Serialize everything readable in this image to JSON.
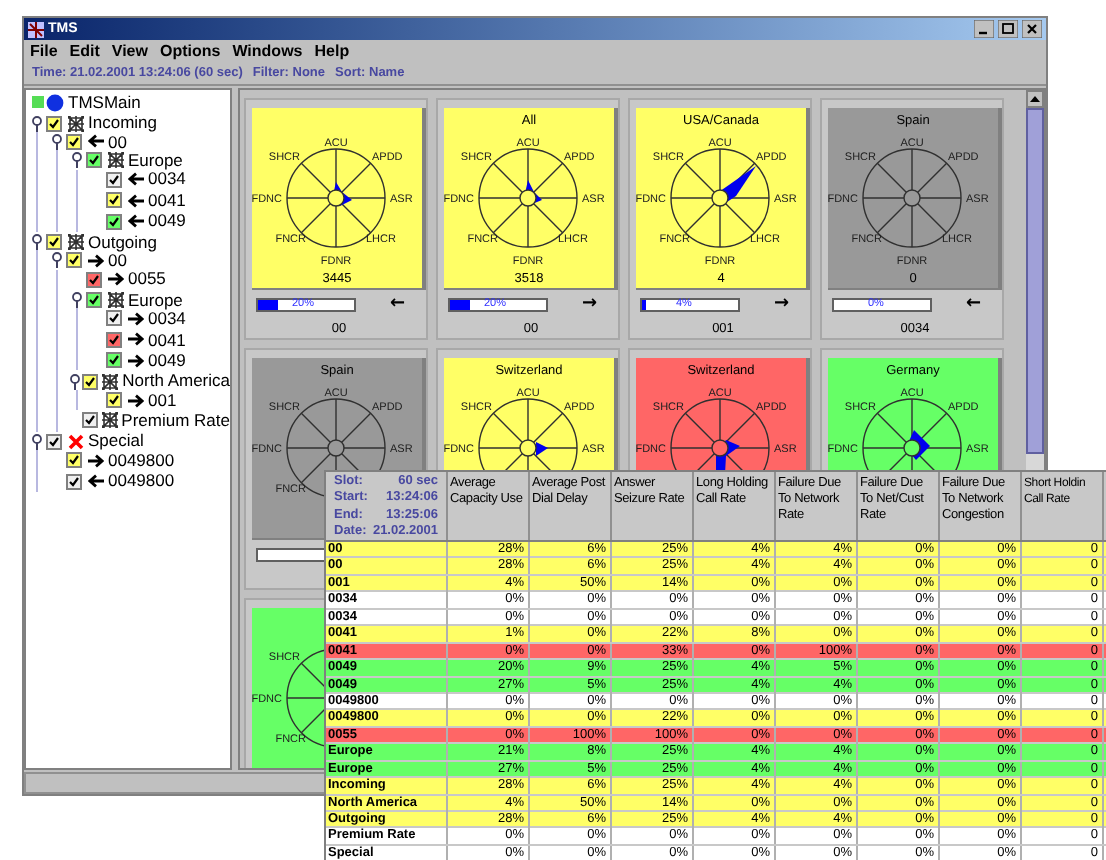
{
  "window": {
    "title": "TMS"
  },
  "menu": [
    "File",
    "Edit",
    "View",
    "Options",
    "Windows",
    "Help"
  ],
  "info": [
    "Time: 21.02.2001 13:24:06 (60 sec)",
    "Filter: None",
    "Sort: Name"
  ],
  "tree": {
    "root": {
      "label": "TMSMain",
      "children": [
        {
          "label": "Incoming",
          "kind": "group",
          "color": "#ffff66",
          "checked": true,
          "expanded": true,
          "children": [
            {
              "label": "00",
              "kind": "in",
              "color": "#ffff66",
              "checked": true,
              "expanded": true,
              "children": [
                {
                  "label": "Europe",
                  "kind": "group",
                  "color": "#66ff66",
                  "checked": true,
                  "expanded": true,
                  "children": [
                    {
                      "label": "0034",
                      "kind": "in",
                      "color": "#f0f0f0",
                      "checked": true
                    },
                    {
                      "label": "0041",
                      "kind": "in",
                      "color": "#ffff66",
                      "checked": true
                    },
                    {
                      "label": "0049",
                      "kind": "in",
                      "color": "#66ff66",
                      "checked": true
                    }
                  ]
                }
              ]
            }
          ]
        },
        {
          "label": "Outgoing",
          "kind": "group",
          "color": "#ffff66",
          "checked": true,
          "expanded": true,
          "children": [
            {
              "label": "00",
              "kind": "out",
              "color": "#ffff66",
              "checked": true,
              "expanded": true,
              "children": [
                {
                  "label": "0055",
                  "kind": "out",
                  "color": "#ff6666",
                  "checked": true
                },
                {
                  "label": "Europe",
                  "kind": "group",
                  "color": "#66ff66",
                  "checked": true,
                  "expanded": true,
                  "children": [
                    {
                      "label": "0034",
                      "kind": "out",
                      "color": "#f0f0f0",
                      "checked": true
                    },
                    {
                      "label": "0041",
                      "kind": "out",
                      "color": "#ff6666",
                      "checked": true
                    },
                    {
                      "label": "0049",
                      "kind": "out",
                      "color": "#66ff66",
                      "checked": true
                    }
                  ]
                },
                {
                  "label": "North America",
                  "kind": "group",
                  "color": "#ffff66",
                  "checked": true,
                  "expanded": true,
                  "children": [
                    {
                      "label": "001",
                      "kind": "out",
                      "color": "#ffff66",
                      "checked": true
                    }
                  ]
                },
                {
                  "label": "Premium Rate",
                  "kind": "group",
                  "color": "#f0f0f0",
                  "checked": true
                }
              ]
            }
          ]
        },
        {
          "label": "Special",
          "kind": "special",
          "color": "#f0f0f0",
          "checked": true,
          "expanded": true,
          "children": [
            {
              "label": "0049800",
              "kind": "out",
              "color": "#ffff66",
              "checked": true
            },
            {
              "label": "0049800",
              "kind": "in",
              "color": "#f0f0f0",
              "checked": true
            }
          ]
        }
      ]
    }
  },
  "cards": [
    {
      "color": "#ffff66",
      "axes": {
        "n": "ACU",
        "ne": "APDD",
        "e": "ASR",
        "se": "LHCR",
        "s": "FDNR",
        "sw": "FNCR",
        "w": "FDNC",
        "nw": "SHCR"
      },
      "count": "3445",
      "level": 0.2,
      "reading": "20%",
      "arrow": "←",
      "code": "00"
    },
    {
      "title": "All",
      "color": "#ffff66",
      "axes": {
        "n": "ACU",
        "ne": "APDD",
        "e": "ASR",
        "se": "LHCR",
        "s": "FDNR",
        "sw": "FNCR",
        "w": "FDNC",
        "nw": "SHCR"
      },
      "count": "3518",
      "level": 0.2,
      "reading": "20%",
      "arrow": "→",
      "code": "00"
    },
    {
      "title": "USA/Canada",
      "color": "#ffff66",
      "axes": {
        "n": "ACU",
        "ne": "APDD",
        "e": "ASR",
        "se": "LHCR",
        "s": "FDNR",
        "sw": "FNCR",
        "w": "FDNC",
        "nw": "SHCR"
      },
      "count": "4",
      "level": 0.04,
      "reading": "4%",
      "arrow": "→",
      "code": "001"
    },
    {
      "title": "Spain",
      "color": "#999999",
      "axes": {
        "n": "ACU",
        "ne": "APDD",
        "e": "ASR",
        "se": "LHCR",
        "s": "FDNR",
        "sw": "FNCR",
        "w": "FDNC",
        "nw": "SHCR"
      },
      "count": "0",
      "level": 0,
      "reading": "0%",
      "arrow": "←",
      "code": "0034"
    },
    {
      "title": "Spain",
      "color": "#999999",
      "axes": {
        "n": "ACU",
        "ne": "APDD",
        "e": "ASR",
        "sw": "FNCR",
        "w": "FDNC",
        "nw": "SHCR"
      },
      "level": 0
    },
    {
      "title": "Switzerland",
      "color": "#ffff66",
      "axes": {
        "n": "ACU",
        "ne": "APDD",
        "e": "ASR",
        "w": "FDNC",
        "nw": "SHCR"
      }
    },
    {
      "title": "Switzerland",
      "color": "#ff6666",
      "axes": {
        "n": "ACU",
        "ne": "APDD",
        "e": "ASR",
        "w": "FDNC",
        "nw": "SHCR"
      }
    },
    {
      "title": "Germany",
      "color": "#66ff66",
      "axes": {
        "n": "ACU",
        "ne": "APDD",
        "e": "ASR",
        "w": "FDNC",
        "nw": "SHCR"
      }
    },
    {
      "color": "#66ff66",
      "axes": {
        "nw": "SHCR",
        "w": "FDNC",
        "sw": "FNCR"
      }
    }
  ],
  "table": {
    "slot": [
      {
        "label": "Slot:",
        "value": "60 sec"
      },
      {
        "label": "Start:",
        "value": "13:24:06"
      },
      {
        "label": "End:",
        "value": "13:25:06"
      },
      {
        "label": "Date:",
        "value": "21.02.2001"
      }
    ],
    "columns": [
      "Average Capacity Use",
      "Average Post Dial Delay",
      "Answer Seizure Rate",
      "Long Holding Call Rate",
      "Failure Due To Network Rate",
      "Failure Due To Net/Cust Rate",
      "Failure Due To Network Congestion",
      "Short Holdin Call Rate"
    ],
    "rows": [
      {
        "color": "#ffff66",
        "name": "00",
        "values": [
          "28%",
          "6%",
          "25%",
          "4%",
          "4%",
          "0%",
          "0%",
          "0"
        ]
      },
      {
        "color": "#ffff66",
        "name": "00",
        "values": [
          "28%",
          "6%",
          "25%",
          "4%",
          "4%",
          "0%",
          "0%",
          "0"
        ]
      },
      {
        "color": "#ffff66",
        "name": "001",
        "values": [
          "4%",
          "50%",
          "14%",
          "0%",
          "0%",
          "0%",
          "0%",
          "0"
        ]
      },
      {
        "color": "#ffffff",
        "name": "0034",
        "values": [
          "0%",
          "0%",
          "0%",
          "0%",
          "0%",
          "0%",
          "0%",
          "0"
        ]
      },
      {
        "color": "#ffffff",
        "name": "0034",
        "values": [
          "0%",
          "0%",
          "0%",
          "0%",
          "0%",
          "0%",
          "0%",
          "0"
        ]
      },
      {
        "color": "#ffff66",
        "name": "0041",
        "values": [
          "1%",
          "0%",
          "22%",
          "8%",
          "0%",
          "0%",
          "0%",
          "0"
        ]
      },
      {
        "color": "#ff6666",
        "name": "0041",
        "values": [
          "0%",
          "0%",
          "33%",
          "0%",
          "100%",
          "0%",
          "0%",
          "0"
        ]
      },
      {
        "color": "#66ff66",
        "name": "0049",
        "values": [
          "20%",
          "9%",
          "25%",
          "4%",
          "5%",
          "0%",
          "0%",
          "0"
        ]
      },
      {
        "color": "#66ff66",
        "name": "0049",
        "values": [
          "27%",
          "5%",
          "25%",
          "4%",
          "4%",
          "0%",
          "0%",
          "0"
        ]
      },
      {
        "color": "#ffffff",
        "name": "0049800",
        "values": [
          "0%",
          "0%",
          "0%",
          "0%",
          "0%",
          "0%",
          "0%",
          "0"
        ]
      },
      {
        "color": "#ffff66",
        "name": "0049800",
        "values": [
          "0%",
          "0%",
          "22%",
          "0%",
          "0%",
          "0%",
          "0%",
          "0"
        ]
      },
      {
        "color": "#ff6666",
        "name": "0055",
        "values": [
          "0%",
          "100%",
          "100%",
          "0%",
          "0%",
          "0%",
          "0%",
          "0"
        ]
      },
      {
        "color": "#66ff66",
        "name": "Europe",
        "values": [
          "21%",
          "8%",
          "25%",
          "4%",
          "4%",
          "0%",
          "0%",
          "0"
        ]
      },
      {
        "color": "#66ff66",
        "name": "Europe",
        "values": [
          "27%",
          "5%",
          "25%",
          "4%",
          "4%",
          "0%",
          "0%",
          "0"
        ]
      },
      {
        "color": "#ffff66",
        "name": "Incoming",
        "values": [
          "28%",
          "6%",
          "25%",
          "4%",
          "4%",
          "0%",
          "0%",
          "0"
        ]
      },
      {
        "color": "#ffff66",
        "name": "North America",
        "values": [
          "4%",
          "50%",
          "14%",
          "0%",
          "0%",
          "0%",
          "0%",
          "0"
        ]
      },
      {
        "color": "#ffff66",
        "name": "Outgoing",
        "values": [
          "28%",
          "6%",
          "25%",
          "4%",
          "4%",
          "0%",
          "0%",
          "0"
        ]
      },
      {
        "color": "#ffffff",
        "name": "Premium Rate",
        "values": [
          "0%",
          "0%",
          "0%",
          "0%",
          "0%",
          "0%",
          "0%",
          "0"
        ]
      },
      {
        "color": "#ffffff",
        "name": "Special",
        "values": [
          "0%",
          "0%",
          "0%",
          "0%",
          "0%",
          "0%",
          "0%",
          "0"
        ]
      }
    ]
  }
}
